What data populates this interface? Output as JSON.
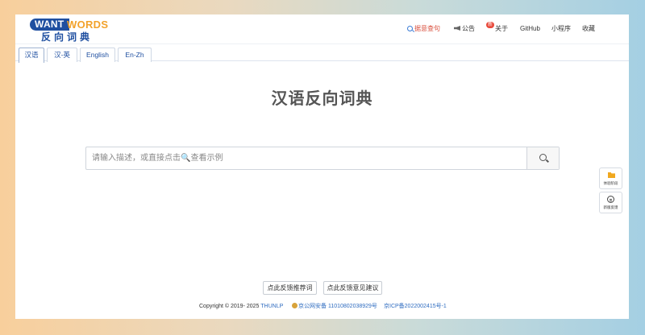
{
  "header": {
    "logo": {
      "want": "WANT",
      "words": "WORDS",
      "cn": "反向词典"
    },
    "nav": {
      "search": "据意查句",
      "notice": "公告",
      "notice_badge": "新",
      "about": "关于",
      "github": "GitHub",
      "miniprogram": "小程序",
      "favorite": "收藏"
    },
    "icons": {
      "search": "search-icon",
      "notice": "megaphone-icon"
    },
    "accent": "#1f4fa0",
    "search_link_color": "#d94f3d"
  },
  "tabs": [
    {
      "label": "汉语",
      "active": true
    },
    {
      "label": "汉-英",
      "active": false
    },
    {
      "label": "English",
      "active": false
    },
    {
      "label": "En-Zh",
      "active": false
    }
  ],
  "main": {
    "title": "汉语反向词典",
    "search_placeholder": "请输入描述，或直接点击🔍查看示例",
    "search_value": ""
  },
  "footer": {
    "recommend_btn": "点此反馈推荐词",
    "feedback_btn": "点此反馈意见建议",
    "copyright": "Copyright © 2019- 2025",
    "org": "THUNLP",
    "police": "京公网安备 11010802038929号",
    "icp": "京ICP备2022002415号-1"
  },
  "side": {
    "test_label": "体验阶段",
    "feedback_label": "新版反馈"
  }
}
